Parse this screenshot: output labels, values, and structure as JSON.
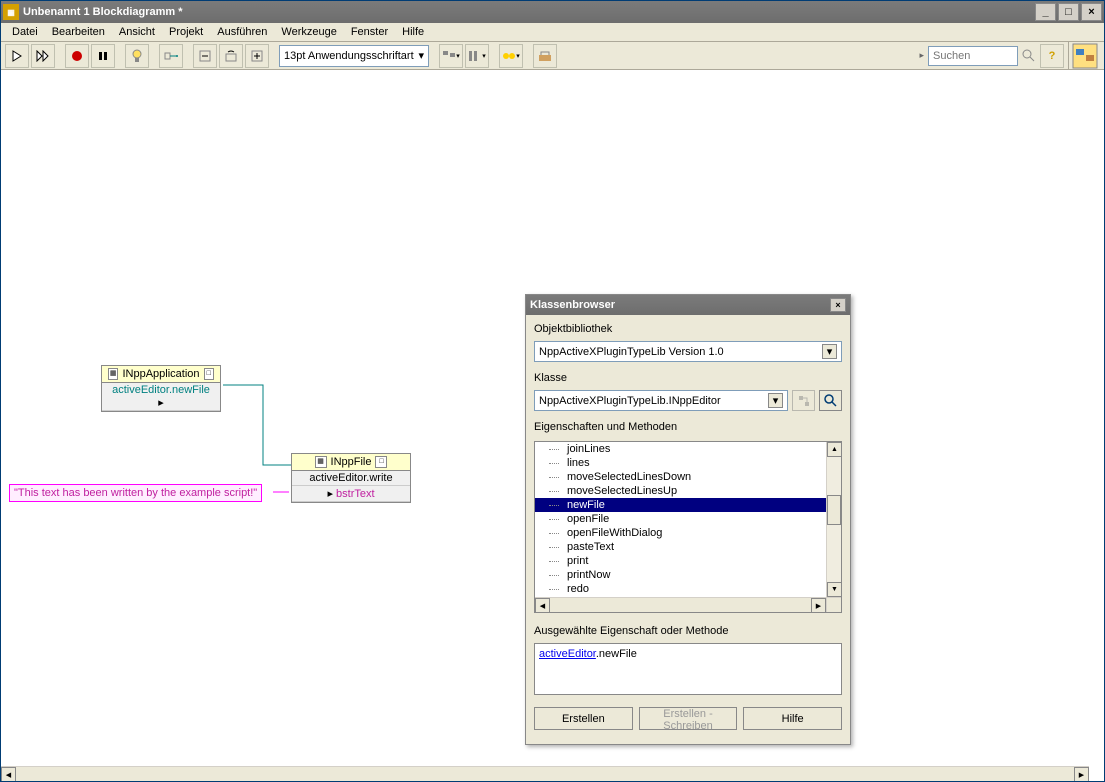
{
  "window": {
    "title": "Unbenannt 1 Blockdiagramm *"
  },
  "menu": {
    "items": [
      "Datei",
      "Bearbeiten",
      "Ansicht",
      "Projekt",
      "Ausführen",
      "Werkzeuge",
      "Fenster",
      "Hilfe"
    ]
  },
  "toolbar": {
    "font": "13pt Anwendungsschriftart",
    "search_placeholder": "Suchen"
  },
  "canvas": {
    "node1": {
      "title": "INppApplication",
      "row": "activeEditor.newFile"
    },
    "node2": {
      "title": "INppFile",
      "row1": "activeEditor.write",
      "row2": "bstrText"
    },
    "string_const": "\"This text has been written by the example script!\""
  },
  "classbrowser": {
    "title": "Klassenbrowser",
    "lib_label": "Objektbibliothek",
    "lib_value": "NppActiveXPluginTypeLib Version 1.0",
    "class_label": "Klasse",
    "class_value": "NppActiveXPluginTypeLib.INppEditor",
    "props_label": "Eigenschaften und Methoden",
    "items": [
      "joinLines",
      "lines",
      "moveSelectedLinesDown",
      "moveSelectedLinesUp",
      "newFile",
      "openFile",
      "openFileWithDialog",
      "pasteText",
      "print",
      "printNow",
      "redo"
    ],
    "selected_index": 4,
    "selected_label": "Ausgewählte Eigenschaft oder Methode",
    "selected_link": "activeEditor",
    "selected_rest": ".newFile",
    "btn_create": "Erstellen",
    "btn_create_write": "Erstellen - Schreiben",
    "btn_help": "Hilfe"
  }
}
